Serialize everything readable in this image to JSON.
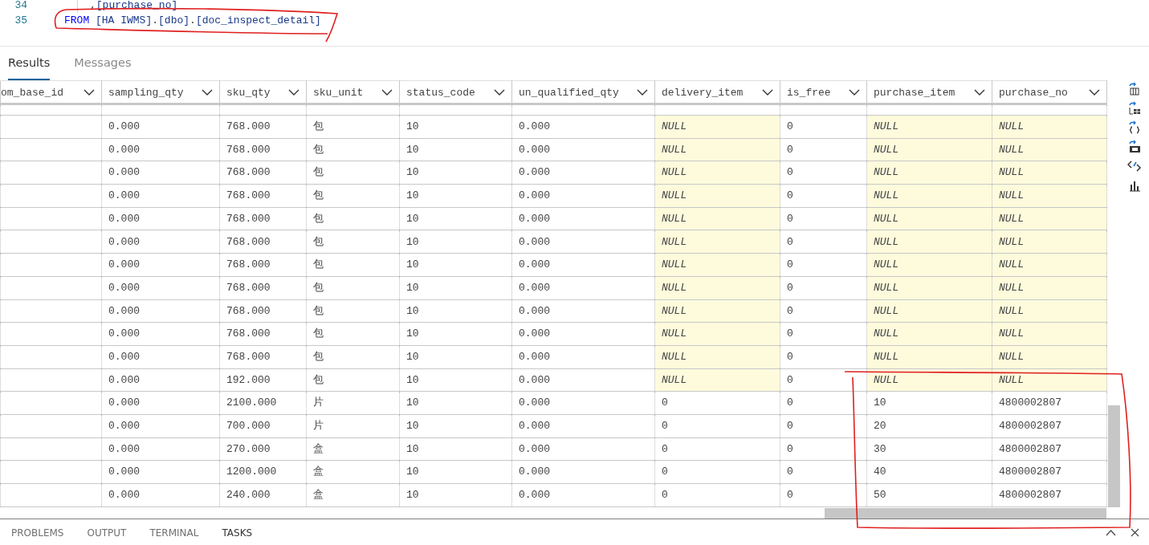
{
  "editor": {
    "lines": [
      {
        "number": "34",
        "indented": true,
        "tokens": [
          {
            "text": ",",
            "kind": "punct"
          },
          {
            "text": "[purchase_no]",
            "kind": "identifier"
          }
        ]
      },
      {
        "number": "35",
        "indented": false,
        "tokens": [
          {
            "text": "FROM ",
            "kind": "keyword"
          },
          {
            "text": "[HA IWMS]",
            "kind": "identifier"
          },
          {
            "text": ".",
            "kind": "punct"
          },
          {
            "text": "[dbo]",
            "kind": "identifier"
          },
          {
            "text": ".",
            "kind": "punct"
          },
          {
            "text": "[doc_inspect_detail]",
            "kind": "identifier"
          }
        ]
      }
    ]
  },
  "result_tabs": [
    {
      "label": "Results",
      "selected": true
    },
    {
      "label": "Messages",
      "selected": false
    }
  ],
  "grid": {
    "columns": [
      "om_base_id",
      "sampling_qty",
      "sku_qty",
      "sku_unit",
      "status_code",
      "un_qualified_qty",
      "delivery_item",
      "is_free",
      "purchase_item",
      "purchase_no"
    ],
    "rows": [
      {
        "cells": [
          "",
          "0.000",
          "768.000",
          "包",
          "10",
          "0.000",
          {
            "text": "NULL",
            "null": true
          },
          "0",
          {
            "text": "NULL",
            "null": true
          },
          {
            "text": "NULL",
            "null": true
          }
        ]
      },
      {
        "cells": [
          "",
          "0.000",
          "768.000",
          "包",
          "10",
          "0.000",
          {
            "text": "NULL",
            "null": true
          },
          "0",
          {
            "text": "NULL",
            "null": true
          },
          {
            "text": "NULL",
            "null": true
          }
        ]
      },
      {
        "cells": [
          "",
          "0.000",
          "768.000",
          "包",
          "10",
          "0.000",
          {
            "text": "NULL",
            "null": true
          },
          "0",
          {
            "text": "NULL",
            "null": true
          },
          {
            "text": "NULL",
            "null": true
          }
        ]
      },
      {
        "cells": [
          "",
          "0.000",
          "768.000",
          "包",
          "10",
          "0.000",
          {
            "text": "NULL",
            "null": true
          },
          "0",
          {
            "text": "NULL",
            "null": true
          },
          {
            "text": "NULL",
            "null": true
          }
        ]
      },
      {
        "cells": [
          "",
          "0.000",
          "768.000",
          "包",
          "10",
          "0.000",
          {
            "text": "NULL",
            "null": true
          },
          "0",
          {
            "text": "NULL",
            "null": true
          },
          {
            "text": "NULL",
            "null": true
          }
        ]
      },
      {
        "cells": [
          "",
          "0.000",
          "768.000",
          "包",
          "10",
          "0.000",
          {
            "text": "NULL",
            "null": true
          },
          "0",
          {
            "text": "NULL",
            "null": true
          },
          {
            "text": "NULL",
            "null": true
          }
        ]
      },
      {
        "cells": [
          "",
          "0.000",
          "768.000",
          "包",
          "10",
          "0.000",
          {
            "text": "NULL",
            "null": true
          },
          "0",
          {
            "text": "NULL",
            "null": true
          },
          {
            "text": "NULL",
            "null": true
          }
        ]
      },
      {
        "cells": [
          "",
          "0.000",
          "768.000",
          "包",
          "10",
          "0.000",
          {
            "text": "NULL",
            "null": true
          },
          "0",
          {
            "text": "NULL",
            "null": true
          },
          {
            "text": "NULL",
            "null": true
          }
        ]
      },
      {
        "cells": [
          "",
          "0.000",
          "768.000",
          "包",
          "10",
          "0.000",
          {
            "text": "NULL",
            "null": true
          },
          "0",
          {
            "text": "NULL",
            "null": true
          },
          {
            "text": "NULL",
            "null": true
          }
        ]
      },
      {
        "cells": [
          "",
          "0.000",
          "768.000",
          "包",
          "10",
          "0.000",
          {
            "text": "NULL",
            "null": true
          },
          "0",
          {
            "text": "NULL",
            "null": true
          },
          {
            "text": "NULL",
            "null": true
          }
        ]
      },
      {
        "cells": [
          "",
          "0.000",
          "768.000",
          "包",
          "10",
          "0.000",
          {
            "text": "NULL",
            "null": true
          },
          "0",
          {
            "text": "NULL",
            "null": true
          },
          {
            "text": "NULL",
            "null": true
          }
        ]
      },
      {
        "cells": [
          "",
          "0.000",
          "192.000",
          "包",
          "10",
          "0.000",
          {
            "text": "NULL",
            "null": true
          },
          "0",
          {
            "text": "NULL",
            "null": true
          },
          {
            "text": "NULL",
            "null": true
          }
        ]
      },
      {
        "cells": [
          "",
          "0.000",
          "2100.000",
          "片",
          "10",
          "0.000",
          "0",
          "0",
          "10",
          "4800002807"
        ]
      },
      {
        "cells": [
          "",
          "0.000",
          "700.000",
          "片",
          "10",
          "0.000",
          "0",
          "0",
          "20",
          "4800002807"
        ]
      },
      {
        "cells": [
          "",
          "0.000",
          "270.000",
          "盒",
          "10",
          "0.000",
          "0",
          "0",
          "30",
          "4800002807"
        ]
      },
      {
        "cells": [
          "",
          "0.000",
          "1200.000",
          "盒",
          "10",
          "0.000",
          "0",
          "0",
          "40",
          "4800002807"
        ]
      },
      {
        "cells": [
          "",
          "0.000",
          "240.000",
          "盒",
          "10",
          "0.000",
          "0",
          "0",
          "50",
          "4800002807"
        ]
      }
    ]
  },
  "panel_tabs": [
    {
      "label": "PROBLEMS",
      "selected": false
    },
    {
      "label": "OUTPUT",
      "selected": false
    },
    {
      "label": "TERMINAL",
      "selected": false
    },
    {
      "label": "TASKS",
      "selected": true
    }
  ]
}
